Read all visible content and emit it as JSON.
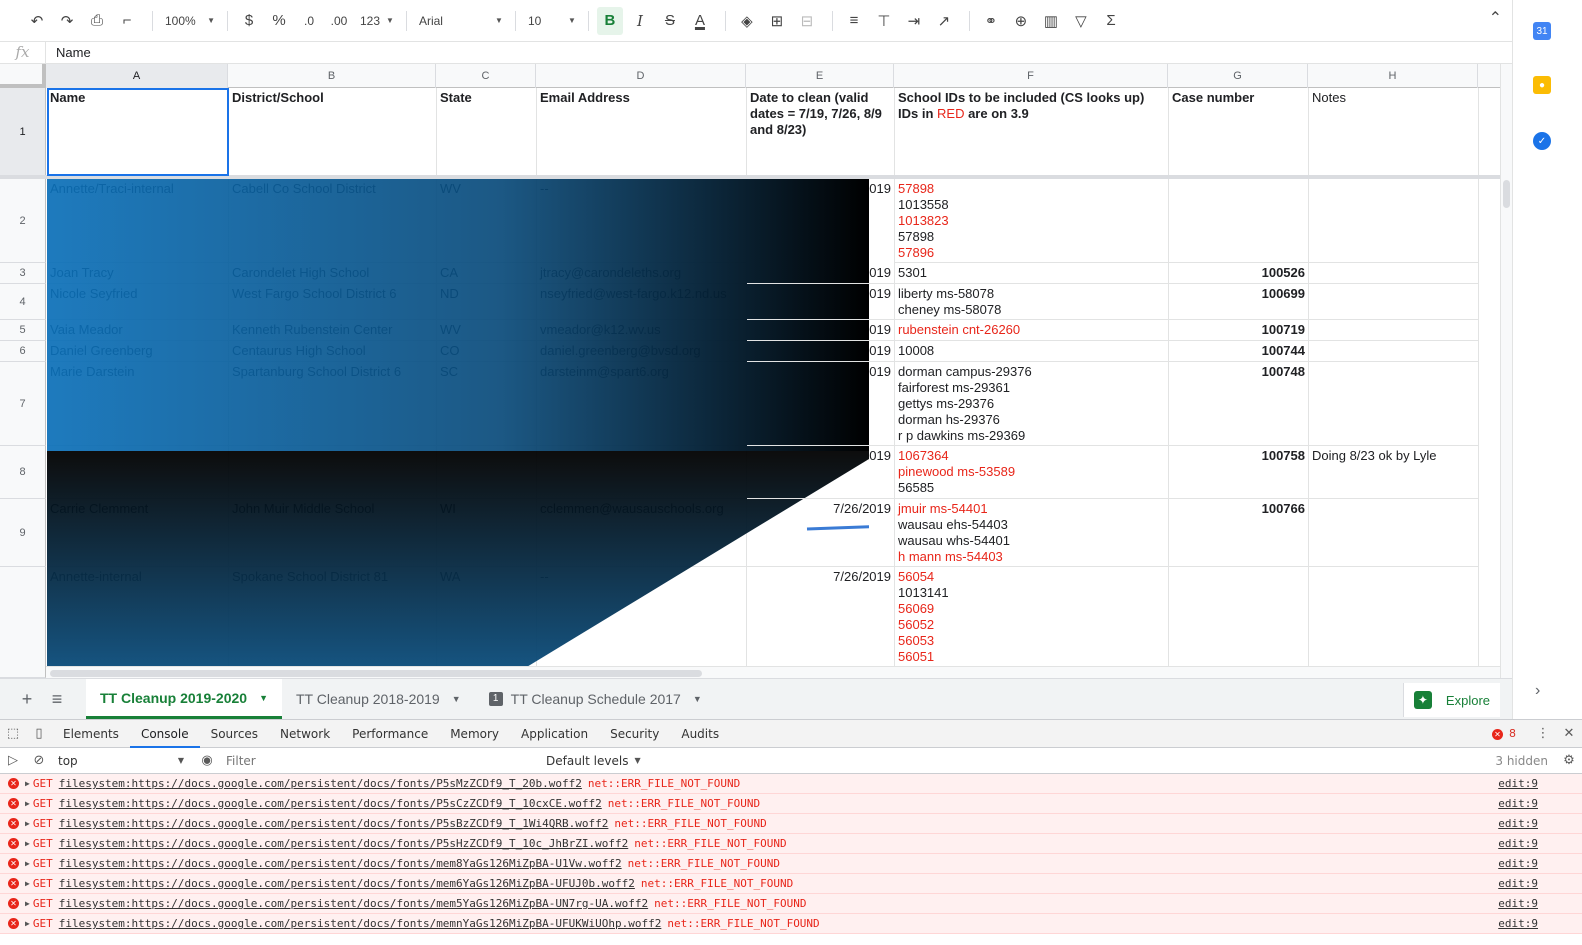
{
  "toolbar": {
    "zoom": "100%",
    "currency": "$",
    "percent": "%",
    "dec_less": ".0",
    "dec_more": ".00",
    "format_more": "123",
    "font": "Arial",
    "font_size": "10",
    "bold": "B",
    "italic": "I",
    "strike": "S",
    "text_color": "A",
    "function": "Σ"
  },
  "formula_bar": {
    "fx": "fx",
    "value": "Name"
  },
  "columns": [
    "A",
    "B",
    "C",
    "D",
    "E",
    "F",
    "G",
    "H"
  ],
  "rows": [
    "1",
    "2",
    "3",
    "4",
    "5",
    "6",
    "7",
    "8",
    "9"
  ],
  "header": {
    "name": "Name",
    "district": "District/School",
    "state": "State",
    "email": "Email Address",
    "date": "Date to clean (valid dates =  7/19, 7/26, 8/9 and 8/23)",
    "school_ids_a": "School IDs to be included (CS looks up) IDs in ",
    "school_ids_red": "RED",
    "school_ids_b": " are on 3.9",
    "case": "Case number",
    "notes": "Notes"
  },
  "data_rows": [
    {
      "name": "Annette/Traci-internal",
      "district": "Cabell Co School District",
      "state": "WV",
      "email": "--",
      "date": "019",
      "case": ""
    },
    {
      "name": "Joan Tracy",
      "district": "Carondelet High School",
      "state": "CA",
      "email": "jtracy@carondeleths.org",
      "date": "019",
      "case": "100526"
    },
    {
      "name": "Nicole Seyfried",
      "district": "West Fargo School District 6",
      "state": "ND",
      "email": "nseyfried@west-fargo.k12.nd.us",
      "date": "019",
      "case": "100699"
    },
    {
      "name": "Vaia Meador",
      "district": "Kenneth Rubenstein Center",
      "state": "WV",
      "email": "vmeador@k12.wv.us",
      "date": "019",
      "case": "100719"
    },
    {
      "name": "Daniel Greenberg",
      "district": "Centaurus High School",
      "state": "CO",
      "email": "daniel.greenberg@bvsd.org",
      "date": "019",
      "case": "100744"
    },
    {
      "name": "Marie Darstein",
      "district": "Spartanburg School District 6",
      "state": "SC",
      "email": "darsteinm@spart6.org",
      "date": "019",
      "case": "100748"
    },
    {
      "name": "",
      "district": "",
      "state": "",
      "email": "",
      "date": "019",
      "case": "100758",
      "notes": "Doing 8/23 ok by Lyle"
    },
    {
      "name": "Carrie Clemment",
      "district": "John Muir Middle School",
      "state": "WI",
      "email": "cclemmen@wausauschools.org",
      "date": "7/26/2019",
      "case": "100766"
    },
    {
      "name": "Annette-internal",
      "district": "Spokane School District 81",
      "state": "WA",
      "email": "--",
      "date": "7/26/2019",
      "case": ""
    }
  ],
  "school_ids": {
    "r2": [
      {
        "t": "57898",
        "red": true
      },
      {
        "t": "1013558",
        "red": false
      },
      {
        "t": "1013823",
        "red": true
      },
      {
        "t": "57898",
        "red": false
      },
      {
        "t": "57896",
        "red": true
      }
    ],
    "r3": [
      {
        "t": "5301",
        "red": false
      }
    ],
    "r4": [
      {
        "t": "liberty ms-58078",
        "red": false
      },
      {
        "t": "cheney ms-58078",
        "red": false
      }
    ],
    "r5": [
      {
        "t": "rubenstein cnt-26260",
        "red": true
      }
    ],
    "r6": [
      {
        "t": "10008",
        "red": false
      }
    ],
    "r7": [
      {
        "t": "dorman campus-29376",
        "red": false
      },
      {
        "t": "fairforest ms-29361",
        "red": false
      },
      {
        "t": "gettys ms-29376",
        "red": false
      },
      {
        "t": "dorman hs-29376",
        "red": false
      },
      {
        "t": "r p dawkins ms-29369",
        "red": false
      }
    ],
    "r8": [
      {
        "t": "1067364",
        "red": true
      },
      {
        "t": "pinewood ms-53589",
        "red": true
      },
      {
        "t": "56585",
        "red": false
      }
    ],
    "r9": [
      {
        "t": "jmuir ms-54401",
        "red": true
      },
      {
        "t": "wausau ehs-54403",
        "red": false
      },
      {
        "t": "wausau whs-54401",
        "red": false
      },
      {
        "t": "h mann ms-54403",
        "red": true
      }
    ],
    "r10": [
      {
        "t": "56054",
        "red": true
      },
      {
        "t": "1013141",
        "red": false
      },
      {
        "t": "56069",
        "red": true
      },
      {
        "t": "56052",
        "red": true
      },
      {
        "t": "56053",
        "red": true
      },
      {
        "t": "56051",
        "red": true
      }
    ]
  },
  "sheet_tabs": {
    "add": "+",
    "all": "≡",
    "tab1": "TT Cleanup 2019-2020",
    "tab2": "TT Cleanup 2018-2019",
    "tab3": "TT Cleanup Schedule 2017",
    "explore": "Explore"
  },
  "devtools": {
    "tabs": [
      "Elements",
      "Console",
      "Sources",
      "Network",
      "Performance",
      "Memory",
      "Application",
      "Security",
      "Audits"
    ],
    "active_tab": "Console",
    "error_count": "8",
    "context": "top",
    "filter_placeholder": "Filter",
    "levels": "Default levels",
    "hidden": "3 hidden",
    "logs": [
      {
        "method": "GET",
        "url": "filesystem:https://docs.google.com/persistent/docs/fonts/P5sMzZCDf9_T_20b.woff2",
        "err": "net::ERR_FILE_NOT_FOUND",
        "src": "edit:9"
      },
      {
        "method": "GET",
        "url": "filesystem:https://docs.google.com/persistent/docs/fonts/P5sCzZCDf9_T_10cxCE.woff2",
        "err": "net::ERR_FILE_NOT_FOUND",
        "src": "edit:9"
      },
      {
        "method": "GET",
        "url": "filesystem:https://docs.google.com/persistent/docs/fonts/P5sBzZCDf9_T_1Wi4QRB.woff2",
        "err": "net::ERR_FILE_NOT_FOUND",
        "src": "edit:9"
      },
      {
        "method": "GET",
        "url": "filesystem:https://docs.google.com/persistent/docs/fonts/P5sHzZCDf9_T_10c_JhBrZI.woff2",
        "err": "net::ERR_FILE_NOT_FOUND",
        "src": "edit:9"
      },
      {
        "method": "GET",
        "url": "filesystem:https://docs.google.com/persistent/docs/fonts/mem8YaGs126MiZpBA-U1Vw.woff2",
        "err": "net::ERR_FILE_NOT_FOUND",
        "src": "edit:9"
      },
      {
        "method": "GET",
        "url": "filesystem:https://docs.google.com/persistent/docs/fonts/mem6YaGs126MiZpBA-UFUJ0b.woff2",
        "err": "net::ERR_FILE_NOT_FOUND",
        "src": "edit:9"
      },
      {
        "method": "GET",
        "url": "filesystem:https://docs.google.com/persistent/docs/fonts/mem5YaGs126MiZpBA-UN7rg-UA.woff2",
        "err": "net::ERR_FILE_NOT_FOUND",
        "src": "edit:9"
      },
      {
        "method": "GET",
        "url": "filesystem:https://docs.google.com/persistent/docs/fonts/memnYaGs126MiZpBA-UFUKWiUOhp.woff2",
        "err": "net::ERR_FILE_NOT_FOUND",
        "src": "edit:9"
      }
    ]
  },
  "colors": {
    "accent_green": "#188038",
    "error_red": "#e8261a",
    "selection_blue": "#1a73e8"
  }
}
